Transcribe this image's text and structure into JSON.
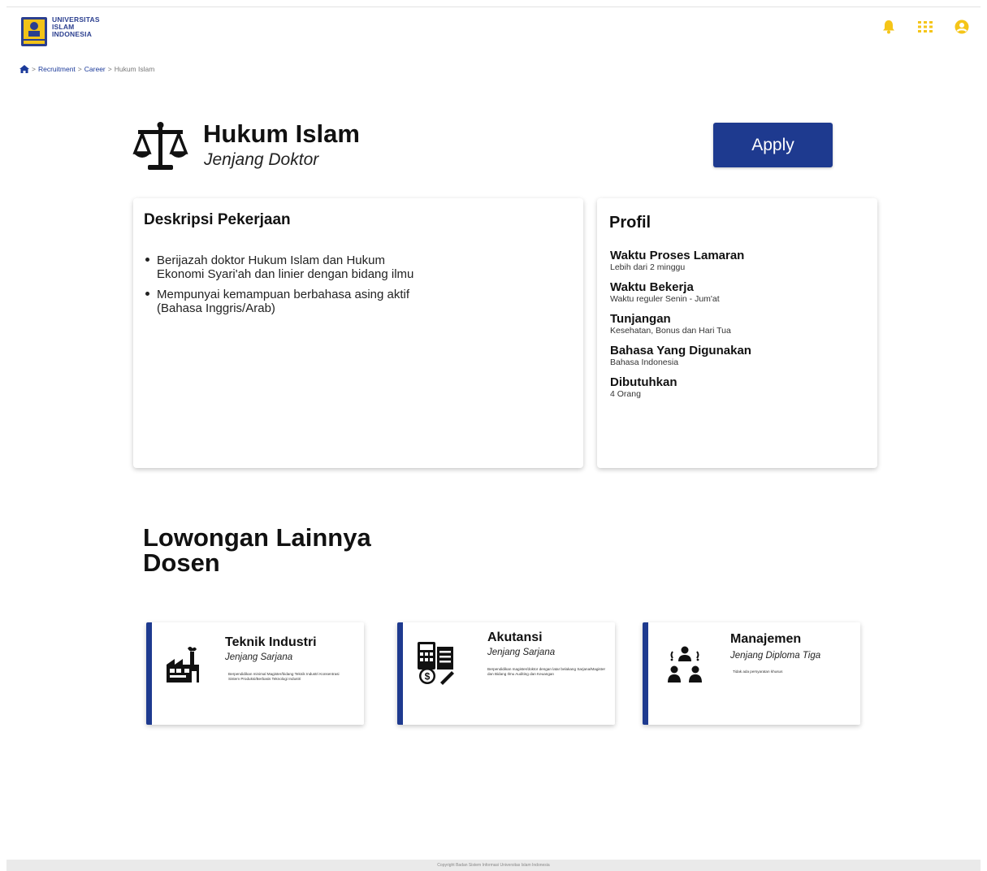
{
  "header": {
    "logo": {
      "line1": "UNIVERSITAS",
      "line2": "ISLAM",
      "line3": "INDONESIA",
      "icon": "university-seal-icon"
    },
    "icons": [
      "bell-icon",
      "apps-grid-icon",
      "user-account-icon"
    ],
    "accent_color": "#f5c518"
  },
  "breadcrumb": {
    "home_icon": "home-icon",
    "items": [
      "Recruitment",
      "Career",
      "Hukum Islam"
    ],
    "separator": ">"
  },
  "job": {
    "icon": "scales-of-justice-icon",
    "title": "Hukum Islam",
    "level": "Jenjang Doktor",
    "apply_label": "Apply",
    "button_color": "#1e3a8f"
  },
  "description": {
    "heading": "Deskripsi Pekerjaan",
    "items": [
      "Berijazah doktor Hukum Islam dan Hukum Ekonomi Syari'ah dan linier dengan bidang ilmu",
      "Mempunyai kemampuan berbahasa asing aktif (Bahasa Inggris/Arab)"
    ]
  },
  "profil": {
    "heading": "Profil",
    "items": [
      {
        "label": "Waktu Proses Lamaran",
        "value": "Lebih dari 2 minggu"
      },
      {
        "label": "Waktu Bekerja",
        "value": "Waktu reguler Senin - Jum'at"
      },
      {
        "label": "Tunjangan",
        "value": "Kesehatan, Bonus dan Hari Tua"
      },
      {
        "label": "Bahasa Yang Digunakan",
        "value": "Bahasa Indonesia"
      },
      {
        "label": "Dibutuhkan",
        "value": "4 Orang"
      }
    ]
  },
  "others": {
    "title_line1": "Lowongan Lainnya",
    "title_line2": "Dosen",
    "cards": [
      {
        "icon": "factory-icon",
        "title": "Teknik Industri",
        "level": "Jenjang Sarjana",
        "desc": "Berpendidikan minimal Magister/bidang Teknik Industri Konsentrasi Sistem Produksi/Berbasis Teknologi Industri"
      },
      {
        "icon": "calculator-document-icon",
        "title": "Akutansi",
        "level": "Jenjang Sarjana",
        "desc": "Berpendidikan magister/doktor dengan latar belakang Sarjana/Magister dan Bidang Ilmu Auditing dan Keuangan"
      },
      {
        "icon": "team-meeting-icon",
        "title": "Manajemen",
        "level": "Jenjang Diploma Tiga",
        "desc": "Tidak ada persyaratan khusus"
      }
    ]
  },
  "footer": {
    "text": "Copyright Badan Sistem Informasi Universitas Islam Indonesia"
  }
}
